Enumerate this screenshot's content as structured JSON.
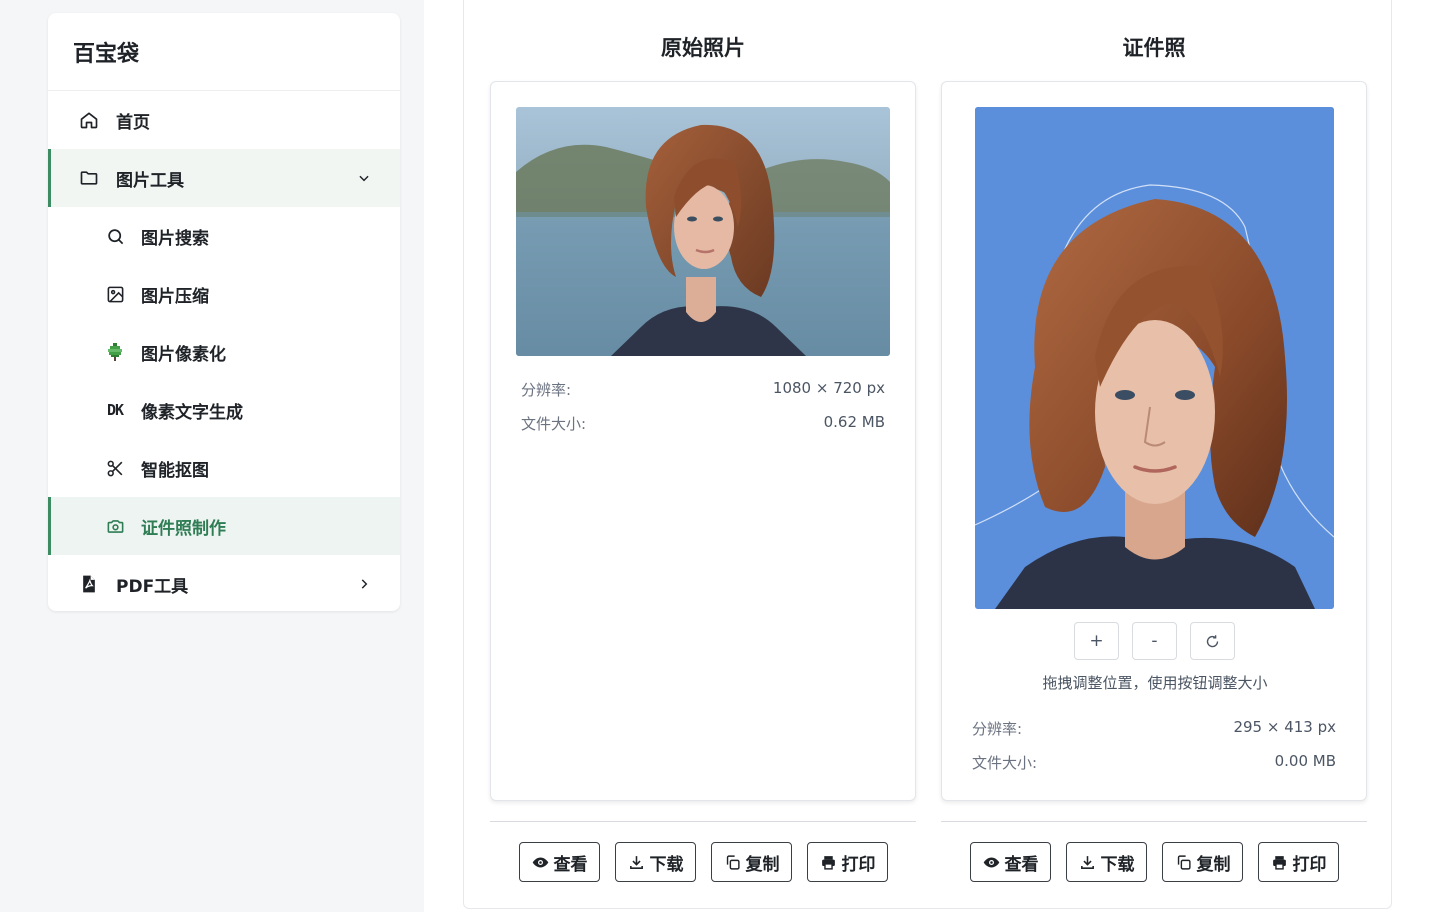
{
  "sidebar": {
    "brand": "百宝袋",
    "items": [
      {
        "label": "首页"
      },
      {
        "label": "图片工具"
      },
      {
        "label": "图片搜索"
      },
      {
        "label": "图片压缩"
      },
      {
        "label": "图片像素化"
      },
      {
        "label": "像素文字生成",
        "icon_text": "DK"
      },
      {
        "label": "智能抠图"
      },
      {
        "label": "证件照制作"
      },
      {
        "label": "PDF工具"
      }
    ]
  },
  "original": {
    "title": "原始照片",
    "resolution_label": "分辨率:",
    "resolution_value": "1080 × 720 px",
    "size_label": "文件大小:",
    "size_value": "0.62 MB"
  },
  "idphoto": {
    "title": "证件照",
    "zoom_in": "+",
    "zoom_out": "-",
    "hint": "拖拽调整位置，使用按钮调整大小",
    "resolution_label": "分辨率:",
    "resolution_value": "295 × 413 px",
    "size_label": "文件大小:",
    "size_value": "0.00 MB",
    "background_color": "#5b8fdc"
  },
  "actions": {
    "view": "查看",
    "download": "下载",
    "copy": "复制",
    "print": "打印"
  },
  "colors": {
    "accent": "#3d8b62",
    "active_bg": "#eef4f1"
  }
}
